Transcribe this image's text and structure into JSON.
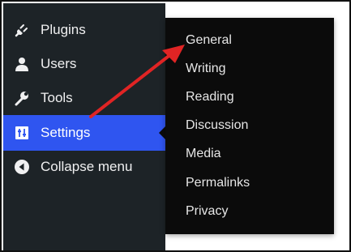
{
  "sidebar": {
    "items": [
      {
        "label": "Plugins",
        "icon": "plug-icon"
      },
      {
        "label": "Users",
        "icon": "user-icon"
      },
      {
        "label": "Tools",
        "icon": "wrench-icon"
      },
      {
        "label": "Settings",
        "icon": "settings-sliders-icon",
        "active": true
      },
      {
        "label": "Collapse menu",
        "icon": "collapse-icon"
      }
    ]
  },
  "submenu": {
    "items": [
      {
        "label": "General"
      },
      {
        "label": "Writing"
      },
      {
        "label": "Reading"
      },
      {
        "label": "Discussion"
      },
      {
        "label": "Media"
      },
      {
        "label": "Permalinks"
      },
      {
        "label": "Privacy"
      }
    ]
  },
  "annotation": {
    "arrow_color": "#e02424"
  },
  "colors": {
    "sidebar_bg": "#1d2327",
    "active_bg": "#2f55f0",
    "submenu_bg": "#0b0b0b"
  }
}
